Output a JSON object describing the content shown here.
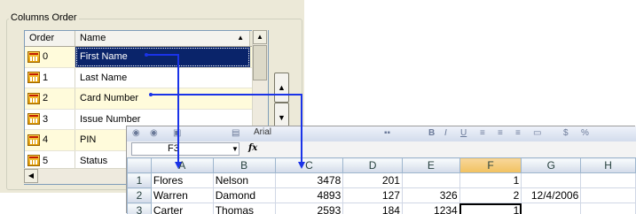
{
  "columns_order": {
    "group_title": "Columns Order",
    "header": {
      "order": "Order",
      "name": "Name",
      "sort_icon": "triangle-up"
    },
    "rows": [
      {
        "order": "0",
        "name": "First Name",
        "selected": true
      },
      {
        "order": "1",
        "name": "Last Name",
        "selected": false
      },
      {
        "order": "2",
        "name": "Card Number",
        "selected": false
      },
      {
        "order": "3",
        "name": "Issue Number",
        "selected": false
      },
      {
        "order": "4",
        "name": "PIN",
        "selected": false
      },
      {
        "order": "5",
        "name": "Status",
        "selected": false
      }
    ],
    "row_icon": "calendar-icon",
    "move_up_icon": "triangle-up",
    "move_down_icon": "triangle-down"
  },
  "excel": {
    "toolbar_font_fragment": "Arial",
    "name_box": "F3",
    "fx_label": "fx",
    "columns": [
      "A",
      "B",
      "C",
      "D",
      "E",
      "F",
      "G",
      "H"
    ],
    "active_column": "F",
    "rows": [
      {
        "num": "1",
        "cells": [
          "Flores",
          "Nelson",
          "3478",
          "201",
          "",
          "1",
          "",
          ""
        ]
      },
      {
        "num": "2",
        "cells": [
          "Warren",
          "Damond",
          "4893",
          "127",
          "326",
          "2",
          "12/4/2006",
          ""
        ]
      },
      {
        "num": "3",
        "cells": [
          "Carter",
          "Thomas",
          "2593",
          "184",
          "1234",
          "1",
          "",
          ""
        ]
      }
    ]
  },
  "colors": {
    "dialog_bg": "#ece9d8",
    "selection": "#0a246a",
    "row_highlight": "#fffbdb",
    "mapping_arrow": "#1a33e8"
  }
}
